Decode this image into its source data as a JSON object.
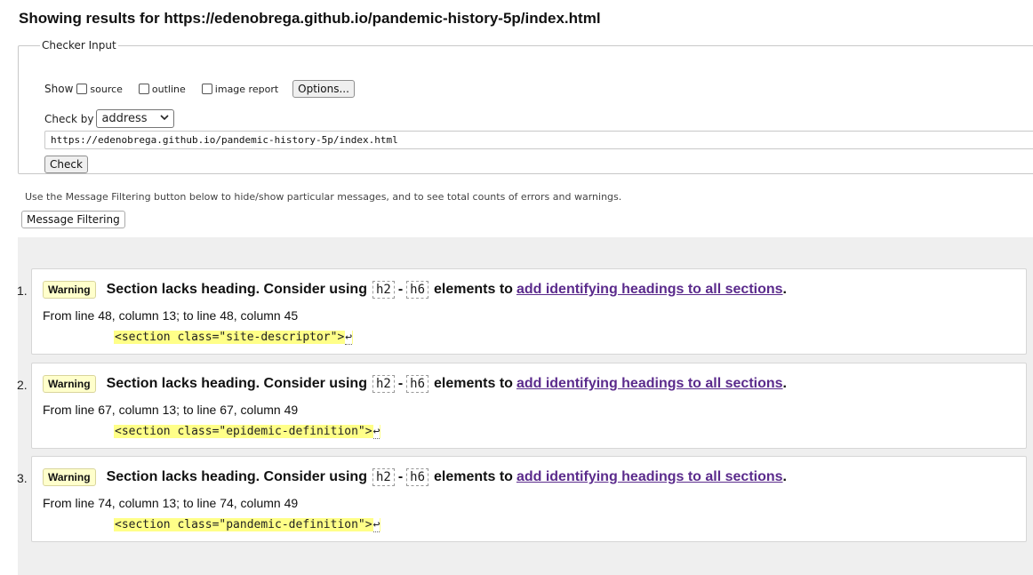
{
  "header": {
    "prefix": "Showing results for ",
    "url": "https://edenobrega.github.io/pandemic-history-5p/index.html"
  },
  "checker": {
    "legend": "Checker Input",
    "show_label": "Show",
    "options": [
      "source",
      "outline",
      "image report"
    ],
    "options_button": "Options...",
    "check_by_label": "Check by",
    "check_by_value": "address",
    "url_value": "https://edenobrega.github.io/pandemic-history-5p/index.html",
    "check_button": "Check"
  },
  "filter": {
    "hint": "Use the Message Filtering button below to hide/show particular messages, and to see total counts of errors and warnings.",
    "button": "Message Filtering"
  },
  "messages": [
    {
      "num": "1.",
      "badge": "Warning",
      "text_a": "Section lacks heading. Consider using",
      "code_a": "h2",
      "dash": "-",
      "code_b": "h6",
      "text_b": "elements to",
      "link": "add identifying headings to all sections",
      "period": ".",
      "location": "From line 48, column 13; to line 48, column 45",
      "extract": "<section class=\"site-descriptor\">"
    },
    {
      "num": "2.",
      "badge": "Warning",
      "text_a": "Section lacks heading. Consider using",
      "code_a": "h2",
      "dash": "-",
      "code_b": "h6",
      "text_b": "elements to",
      "link": "add identifying headings to all sections",
      "period": ".",
      "location": "From line 67, column 13; to line 67, column 49",
      "extract": "<section class=\"epidemic-definition\">"
    },
    {
      "num": "3.",
      "badge": "Warning",
      "text_a": "Section lacks heading. Consider using",
      "code_a": "h2",
      "dash": "-",
      "code_b": "h6",
      "text_b": "elements to",
      "link": "add identifying headings to all sections",
      "period": ".",
      "location": "From line 74, column 13; to line 74, column 49",
      "extract": "<section class=\"pandemic-definition\">"
    }
  ],
  "return_glyph": "↩",
  "colors": {
    "warning_badge": "#ffffcc",
    "extract_highlight": "#ffff88",
    "link": "#5b2b8c",
    "panel_bg": "#efefef"
  }
}
